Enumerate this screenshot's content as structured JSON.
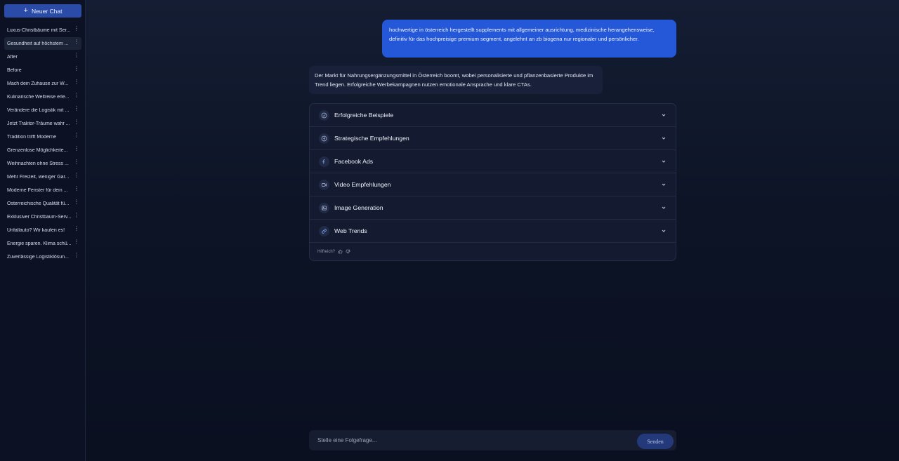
{
  "sidebar": {
    "new_chat_label": "Neuer Chat",
    "items": [
      {
        "label": "Luxus-Christbäume mit Ser..."
      },
      {
        "label": "Gesundheit auf höchstem ..."
      },
      {
        "label": "After"
      },
      {
        "label": "Before"
      },
      {
        "label": "Mach dein Zuhause zur W..."
      },
      {
        "label": "Kulinarische Weltreise erle..."
      },
      {
        "label": "Verändere die Logistik mit ..."
      },
      {
        "label": "Jetzt Traktor-Träume wahr ..."
      },
      {
        "label": "Tradition trifft Moderne"
      },
      {
        "label": "Grenzenlose Möglichkeite..."
      },
      {
        "label": "Weihnachten ohne Stress ..."
      },
      {
        "label": "Mehr Freizeit, weniger Gar..."
      },
      {
        "label": "Moderne Fenster für dein ..."
      },
      {
        "label": "Österreichische Qualität fü..."
      },
      {
        "label": "Exklusiver Christbaum-Serv..."
      },
      {
        "label": "Unfallauto? Wir kaufen es!"
      },
      {
        "label": "Energie sparen. Klima schü..."
      },
      {
        "label": "Zuverlässige Logistiklösun..."
      }
    ],
    "more_glyph": "⋮"
  },
  "chat": {
    "user_message": "hochwertige in österreich hergestellt supplements mit allgemeiner ausrichtung, medizinische herangehensweise, definitiv für das hochpreisige premium segment, angelehnt an zb biogena nur regionaler und persönlicher.",
    "bot_message": "Der Markt für Nahrungsergänzungsmittel in Österreich boomt, wobei personalisierte und pflanzenbasierte Produkte im Trend liegen. Erfolgreiche Werbekampagnen nutzen emotionale Ansprache und klare CTAs."
  },
  "accordion": {
    "sections": [
      {
        "title": "Erfolgreiche Beispiele",
        "icon": "check-circle-icon"
      },
      {
        "title": "Strategische Empfehlungen",
        "icon": "compass-icon"
      },
      {
        "title": "Facebook Ads",
        "icon": "facebook-icon"
      },
      {
        "title": "Video Empfehlungen",
        "icon": "video-icon"
      },
      {
        "title": "Image Generation",
        "icon": "image-icon"
      },
      {
        "title": "Web Trends",
        "icon": "link-icon"
      }
    ],
    "feedback_label": "Hilfreich?"
  },
  "composer": {
    "placeholder": "Stelle eine Folgefrage...",
    "value": "",
    "send_label": "Senden"
  },
  "colors": {
    "accent": "#2458d9",
    "new_chat_button": "#2a4ba8",
    "send_button": "#23397a",
    "background": "#0d1426"
  }
}
